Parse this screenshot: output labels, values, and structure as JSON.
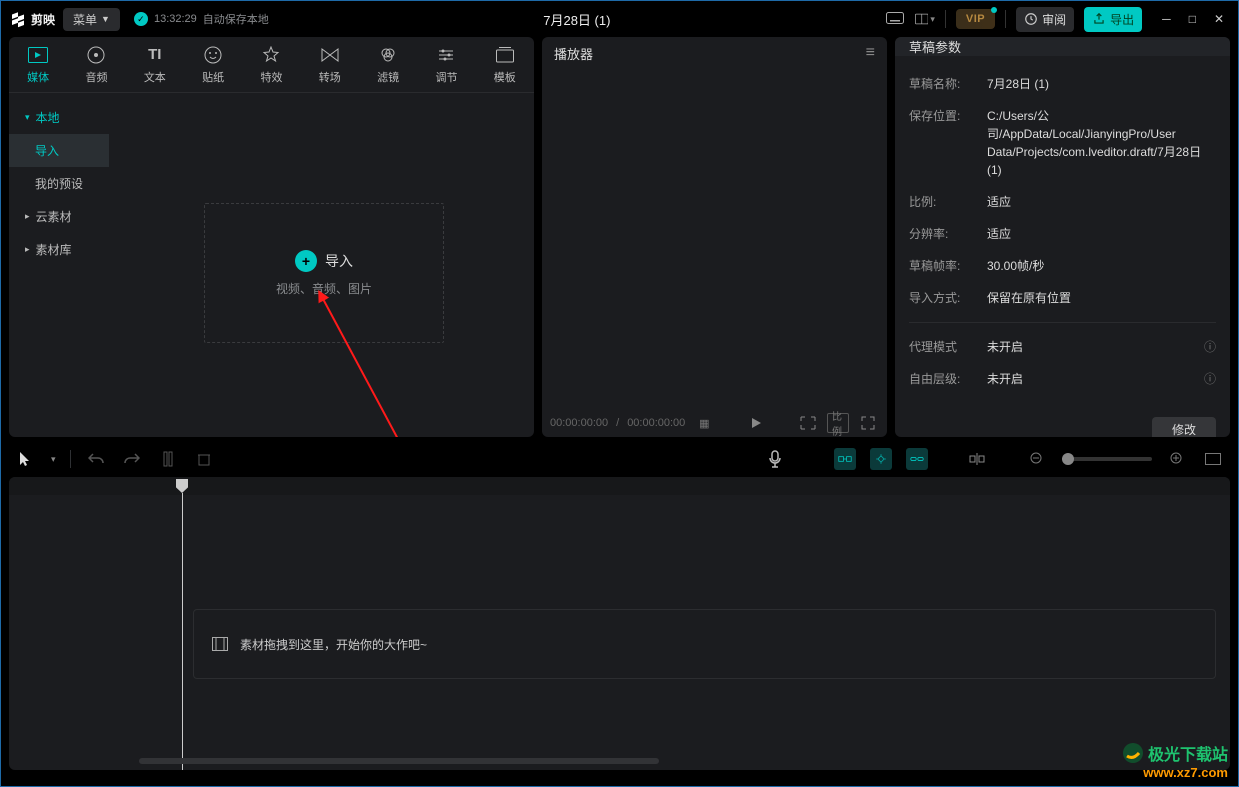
{
  "titlebar": {
    "app_name": "剪映",
    "menu": "菜单",
    "autosave_time": "13:32:29",
    "autosave_text": "自动保存本地",
    "project_title": "7月28日 (1)",
    "vip": "VIP",
    "review": "审阅",
    "export": "导出"
  },
  "asset_tabs": [
    {
      "label": "媒体"
    },
    {
      "label": "音频"
    },
    {
      "label": "文本"
    },
    {
      "label": "贴纸"
    },
    {
      "label": "特效"
    },
    {
      "label": "转场"
    },
    {
      "label": "滤镜"
    },
    {
      "label": "调节"
    },
    {
      "label": "模板"
    }
  ],
  "left_side": {
    "local": "本地",
    "import": "导入",
    "presets": "我的预设",
    "cloud": "云素材",
    "library": "素材库"
  },
  "dropzone": {
    "title": "导入",
    "sub": "视频、音频、图片"
  },
  "player": {
    "title": "播放器",
    "time_current": "00:00:00:00",
    "time_total": "00:00:00:00",
    "ratio": "比例"
  },
  "draft": {
    "header": "草稿参数",
    "rows": {
      "name_label": "草稿名称:",
      "name_value": "7月28日 (1)",
      "path_label": "保存位置:",
      "path_value": "C:/Users/公司/AppData/Local/JianyingPro/User Data/Projects/com.lveditor.draft/7月28日 (1)",
      "ratio_label": "比例:",
      "ratio_value": "适应",
      "res_label": "分辨率:",
      "res_value": "适应",
      "fps_label": "草稿帧率:",
      "fps_value": "30.00帧/秒",
      "import_label": "导入方式:",
      "import_value": "保留在原有位置",
      "proxy_label": "代理模式",
      "proxy_value": "未开启",
      "layer_label": "自由层级:",
      "layer_value": "未开启"
    },
    "modify": "修改"
  },
  "timeline": {
    "placeholder": "素材拖拽到这里，开始你的大作吧~"
  },
  "watermark": {
    "line1": "极光下载站",
    "line2": "www.xz7.com"
  }
}
